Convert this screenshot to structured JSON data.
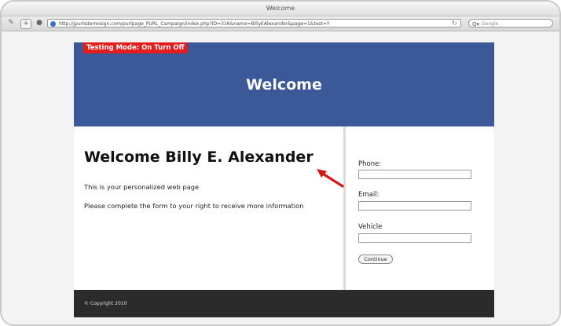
{
  "window": {
    "title": "Welcome"
  },
  "toolbar": {
    "url": "http://jpurlsdemosign.com/purlpage_PURL_Campaign/index.php?ID=316&name=BillyEAlexander&page=1&test=Y",
    "search_placeholder": "Google"
  },
  "page": {
    "testing_badge": "Testing Mode: On Turn Off",
    "hero_title": "Welcome",
    "welcome_heading": "Welcome Billy E. Alexander",
    "paragraphs": [
      "This is your personalized web page",
      "Please complete the form to your right to receive more information"
    ],
    "form": {
      "fields": [
        {
          "label": "Phone:"
        },
        {
          "label": "Email:"
        },
        {
          "label": "Vehicle"
        }
      ],
      "button_label": "Continue"
    },
    "footer": "© Copyright 2010"
  },
  "colors": {
    "hero": "#3b5998",
    "badge": "#e41c1c",
    "footer": "#2b2b2b",
    "arrow": "#d41616"
  }
}
